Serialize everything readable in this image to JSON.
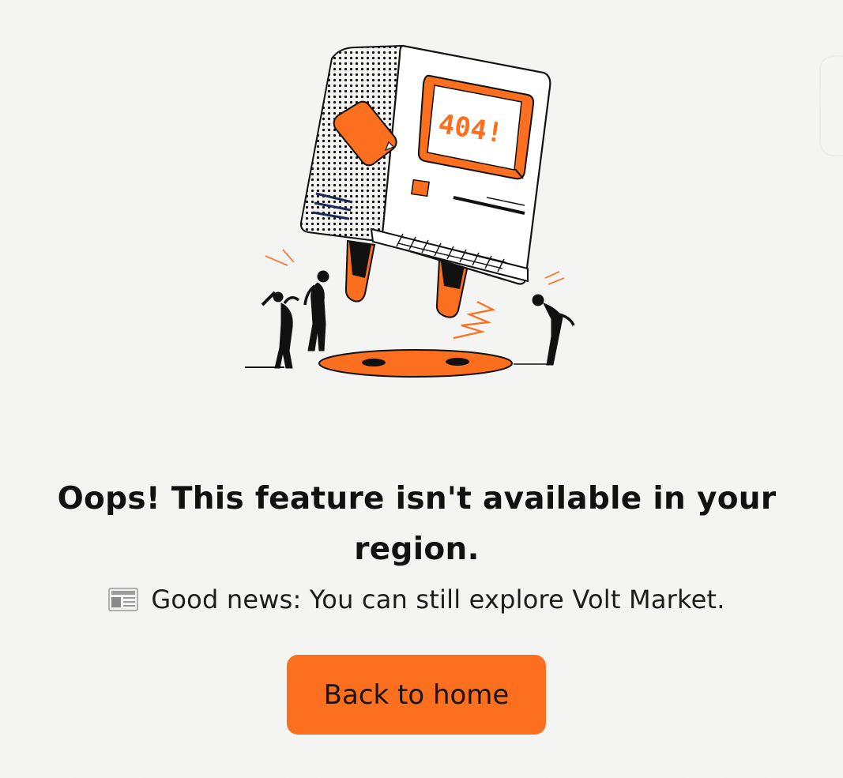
{
  "screen": {
    "title": "Oops! This feature isn't available in your region.",
    "subtitle": "Good news: You can still explore Volt Market.",
    "subtitle_icon": "newspaper-icon",
    "illustration_text": "404!",
    "illustration_icon": "broken-computer-illustration"
  },
  "actions": {
    "back_label": "Back to home"
  },
  "colors": {
    "accent": "#fb6f1e",
    "background": "#f6f6f5",
    "text": "#111111"
  }
}
